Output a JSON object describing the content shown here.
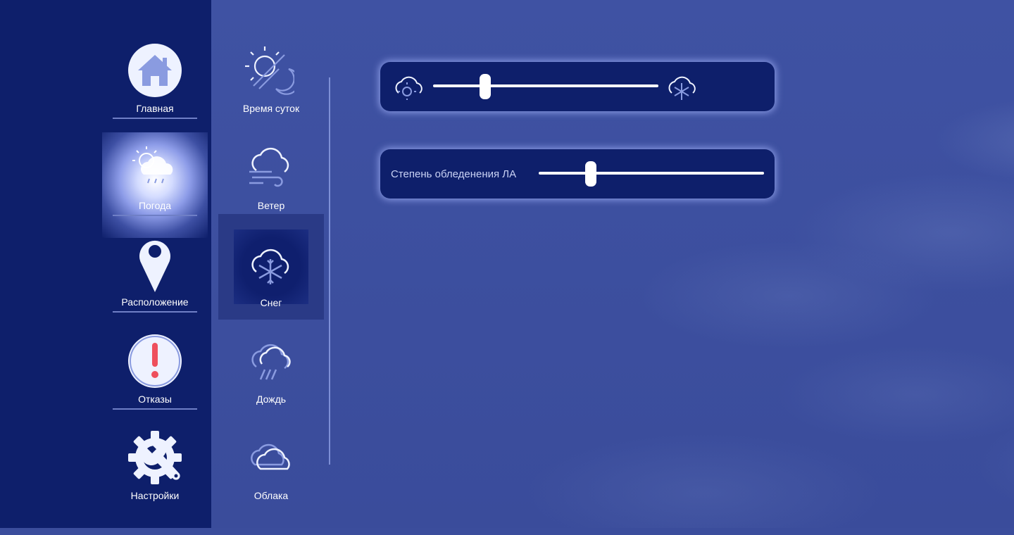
{
  "sidebar": {
    "items": [
      {
        "label": "Главная",
        "icon": "home-icon"
      },
      {
        "label": "Погода",
        "icon": "weather-icon",
        "active": true
      },
      {
        "label": "Расположение",
        "icon": "location-pin-icon"
      },
      {
        "label": "Отказы",
        "icon": "failure-alert-icon"
      },
      {
        "label": "Настройки",
        "icon": "settings-gear-wrench-icon"
      }
    ]
  },
  "weather_menu": {
    "items": [
      {
        "label": "Время суток",
        "icon": "day-night-icon"
      },
      {
        "label": "Ветер",
        "icon": "wind-cloud-icon"
      },
      {
        "label": "Снег",
        "icon": "snow-cloud-icon",
        "active": true
      },
      {
        "label": "Дождь",
        "icon": "rain-cloud-icon"
      },
      {
        "label": "Облака",
        "icon": "clouds-icon"
      }
    ]
  },
  "controls": {
    "snow_intensity": {
      "min_icon": "sun-cloud-icon",
      "max_icon": "snowflake-cloud-icon",
      "value_fraction": 0.23
    },
    "icing": {
      "label": "Степень обледенения ЛА",
      "value_fraction": 0.23
    }
  },
  "colors": {
    "sidebar": "#0e1f6b",
    "background": "#3b4d9c",
    "accent": "#8a9be0",
    "alert": "#ee4f5c"
  }
}
